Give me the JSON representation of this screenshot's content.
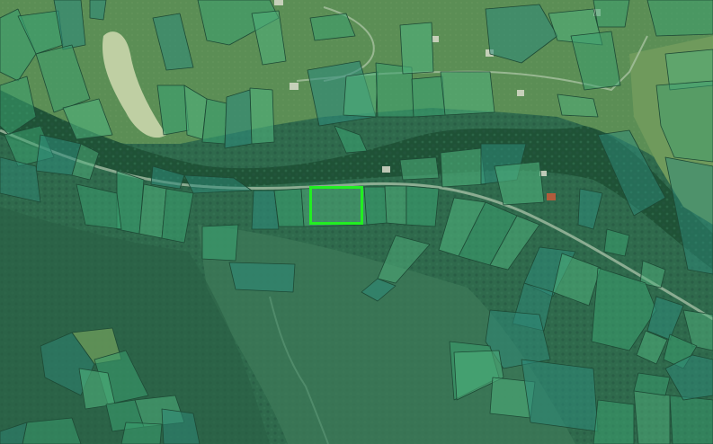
{
  "map": {
    "kind": "satellite-imagery-with-parcel-overlay",
    "colors": {
      "forest_dark": "#2a6048",
      "forest_mid": "#356f52",
      "meadow": "#5a8f5a",
      "meadow_light": "#7fa36a",
      "riverbed": "#b9c9a0",
      "road": "#9bb8a0",
      "parcel_fill": "#3aa070",
      "parcel_fill_light": "#4fb07c",
      "parcel_fill_teal": "#2e8a7a",
      "parcel_stroke": "#1d4a35",
      "selection": "#22ee22"
    },
    "selection": {
      "state": "highlighted",
      "icon": "selection-rectangle"
    }
  }
}
